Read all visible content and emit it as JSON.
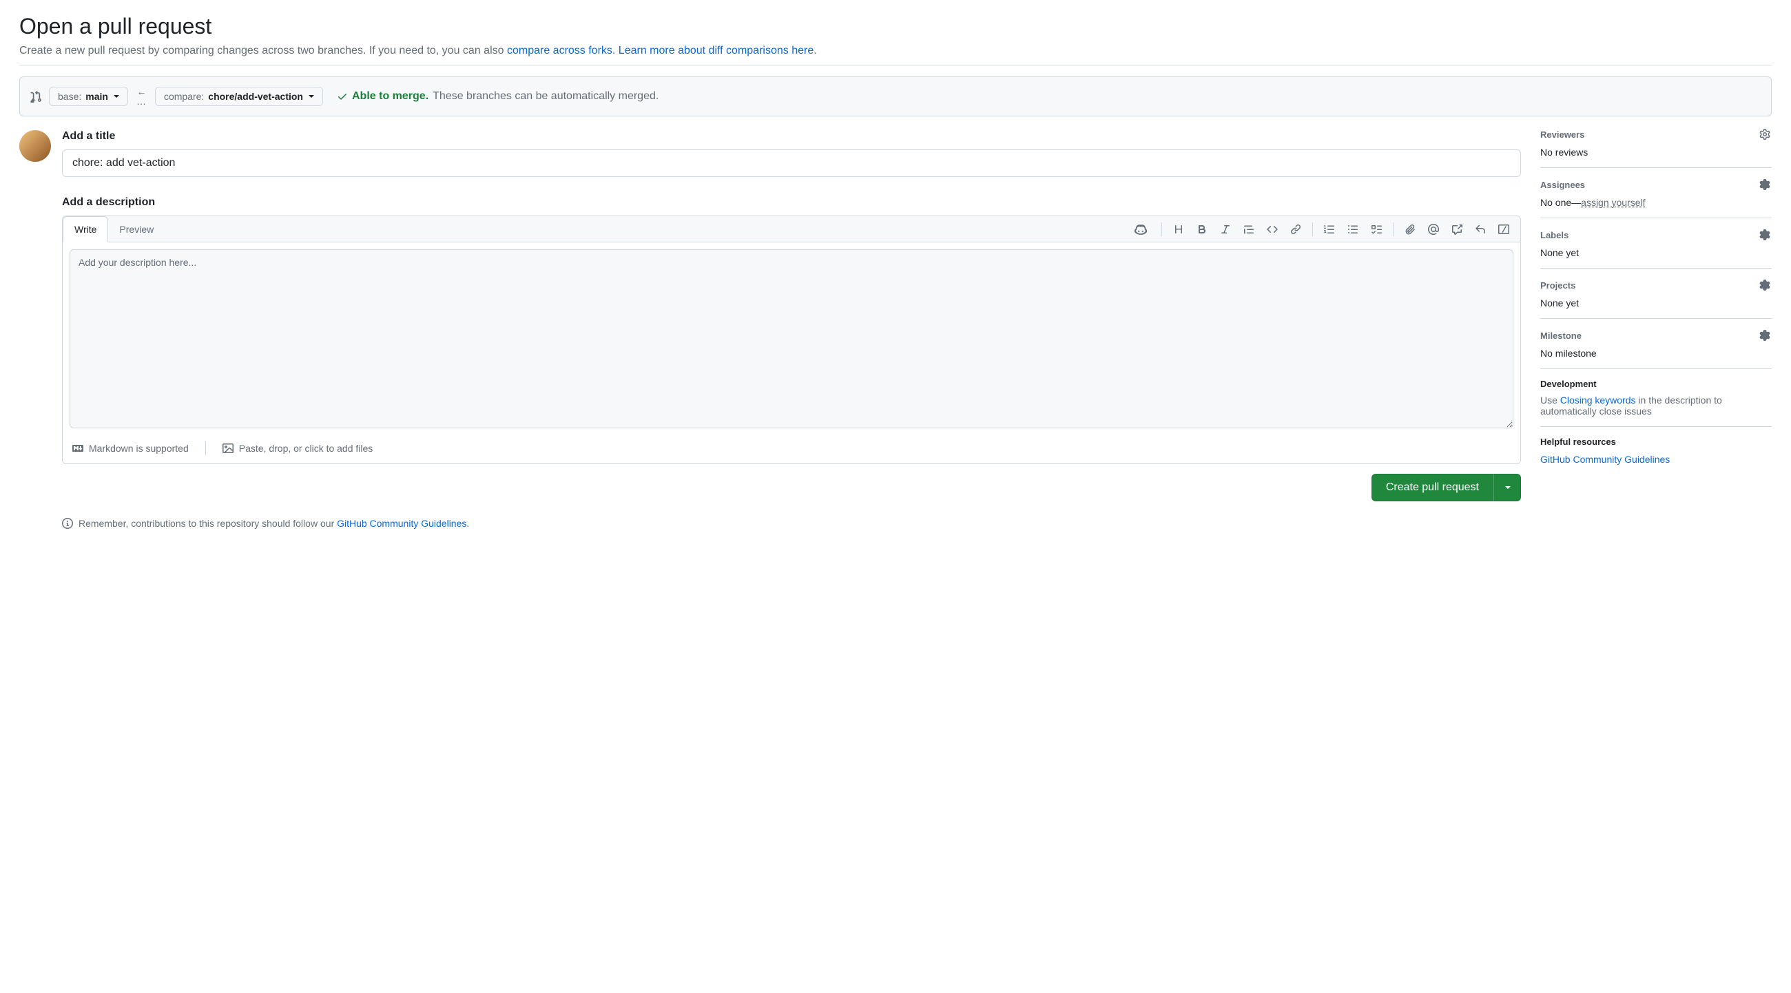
{
  "header": {
    "title": "Open a pull request",
    "subtitle_before_link1": "Create a new pull request by comparing changes across two branches. If you need to, you can also ",
    "link1": "compare across forks",
    "sep1": ". ",
    "link2": "Learn more about diff comparisons here",
    "after": "."
  },
  "compare": {
    "base_label": "base:",
    "base_value": "main",
    "compare_label": "compare:",
    "compare_value": "chore/add-vet-action",
    "able_text": "Able to merge.",
    "merge_text": "These branches can be automatically merged."
  },
  "form": {
    "title_label": "Add a title",
    "title_value": "chore: add vet-action",
    "desc_label": "Add a description",
    "tab_write": "Write",
    "tab_preview": "Preview",
    "desc_placeholder": "Add your description here...",
    "markdown_hint": "Markdown is supported",
    "upload_hint": "Paste, drop, or click to add files",
    "submit_label": "Create pull request"
  },
  "contrib": {
    "prefix": "Remember, contributions to this repository should follow our ",
    "link": "GitHub Community Guidelines",
    "suffix": "."
  },
  "sidebar": {
    "reviewers": {
      "title": "Reviewers",
      "body": "No reviews"
    },
    "assignees": {
      "title": "Assignees",
      "body_prefix": "No one—",
      "self_link": "assign yourself"
    },
    "labels": {
      "title": "Labels",
      "body": "None yet"
    },
    "projects": {
      "title": "Projects",
      "body": "None yet"
    },
    "milestone": {
      "title": "Milestone",
      "body": "No milestone"
    },
    "development": {
      "title": "Development",
      "before": "Use ",
      "link": "Closing keywords",
      "after": " in the description to automatically close issues"
    },
    "helpful": {
      "title": "Helpful resources",
      "link": "GitHub Community Guidelines"
    }
  }
}
